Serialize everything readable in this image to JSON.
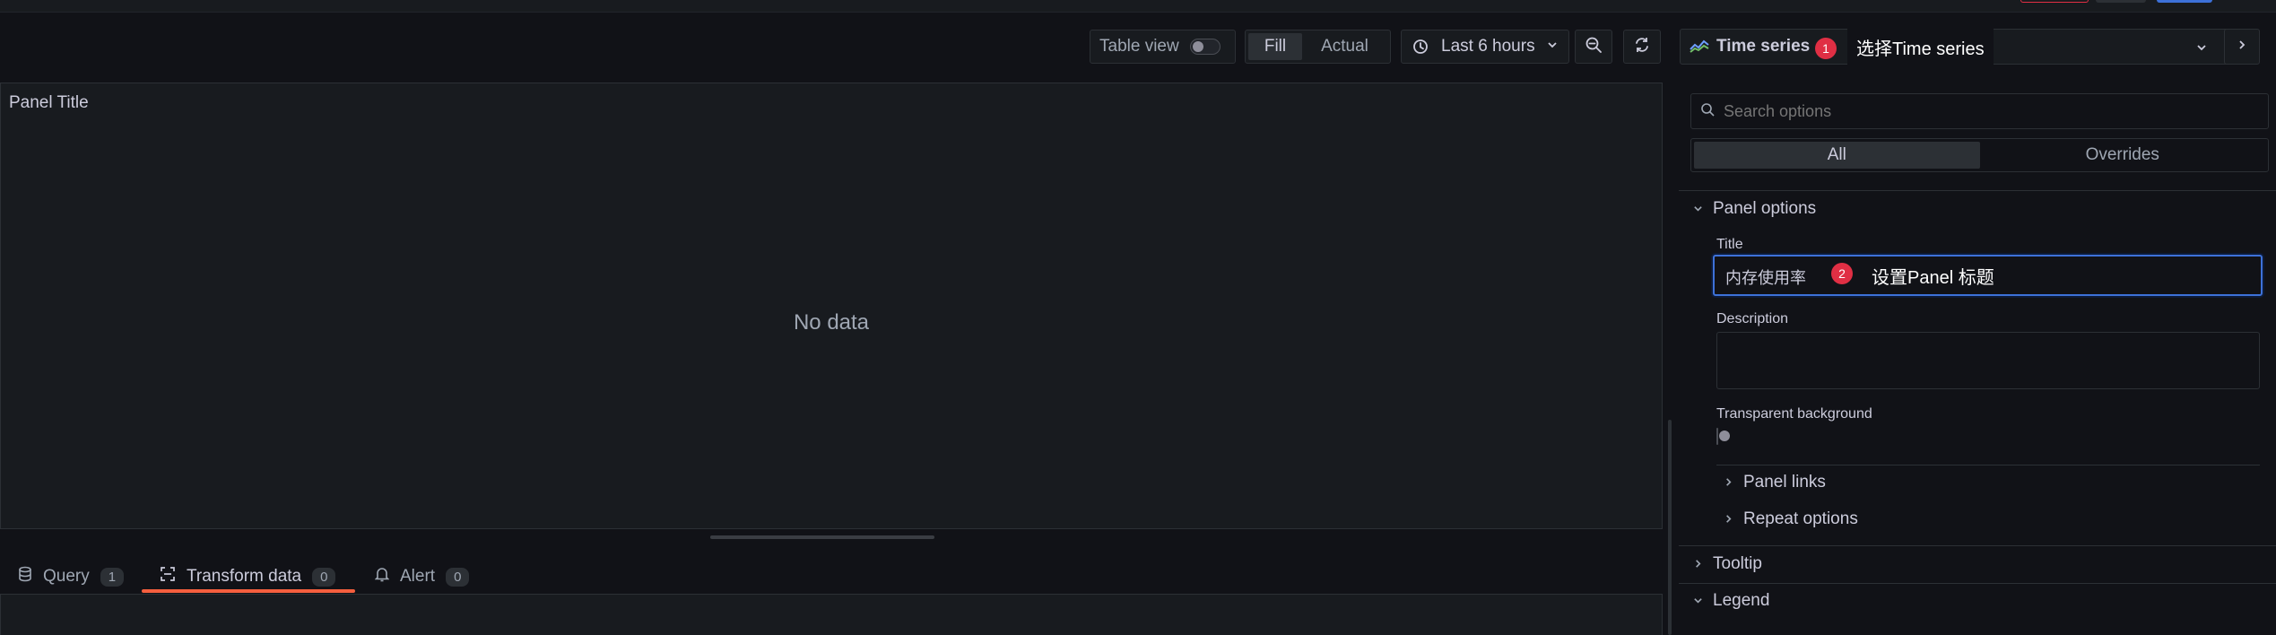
{
  "toolbar": {
    "table_view_label": "Table view",
    "fill_label": "Fill",
    "actual_label": "Actual",
    "time_range_label": "Last 6 hours"
  },
  "panel": {
    "title": "Panel Title",
    "no_data": "No data"
  },
  "tabs": [
    {
      "label": "Query",
      "count": "1"
    },
    {
      "label": "Transform data",
      "count": "0"
    },
    {
      "label": "Alert",
      "count": "0"
    }
  ],
  "options": {
    "viz_name": "Time series",
    "search_placeholder": "Search options",
    "seg_all": "All",
    "seg_overrides": "Overrides",
    "panel_options_label": "Panel options",
    "title_label": "Title",
    "title_value": "内存使用率",
    "description_label": "Description",
    "transparent_label": "Transparent background",
    "panel_links_label": "Panel links",
    "repeat_options_label": "Repeat options",
    "tooltip_label": "Tooltip",
    "legend_label": "Legend"
  },
  "annotations": [
    {
      "number": "1",
      "text": "选择Time series"
    },
    {
      "number": "2",
      "text": "设置Panel 标题"
    }
  ],
  "colors": {
    "accent_tab": "#f55f3e",
    "badge": "#e02f44",
    "focus": "#3d71d9"
  }
}
